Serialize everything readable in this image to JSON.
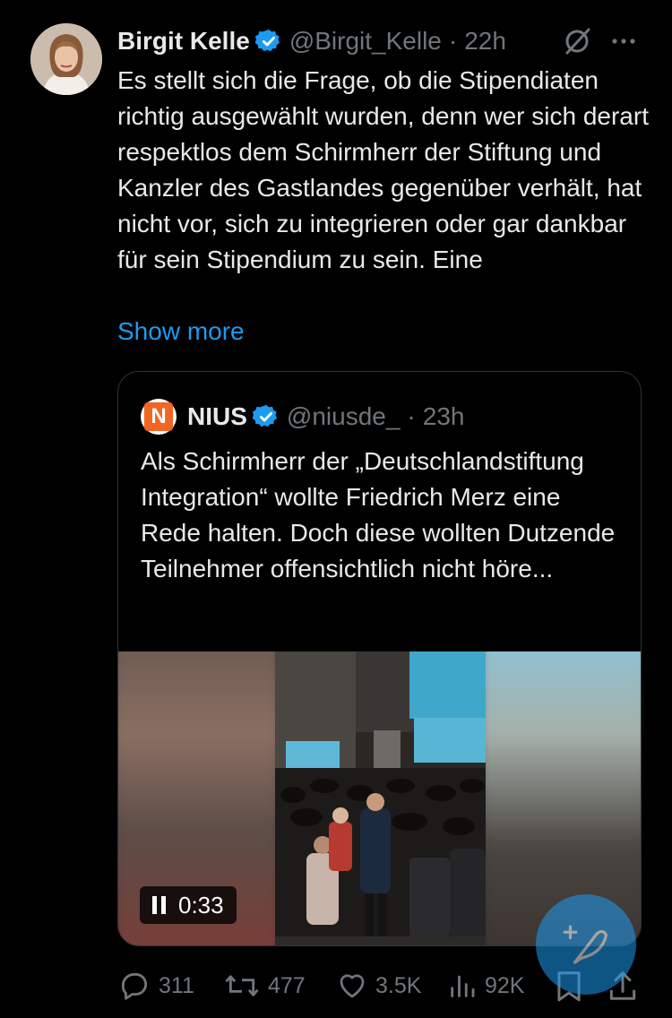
{
  "author": {
    "name": "Birgit Kelle",
    "handle": "@Birgit_Kelle",
    "separator": "·",
    "time": "22h"
  },
  "tweet": {
    "text": "Es stellt sich die Frage, ob die Stipendiaten richtig ausgewählt wurden, denn wer sich derart respektlos dem Schirmherr der Stiftung und Kanzler des Gastlandes gegenüber verhält, hat nicht vor, sich zu integrieren oder gar dankbar für sein Stipendium zu sein. Eine",
    "show_more": "Show more"
  },
  "quote": {
    "logo_letter": "N",
    "name": "NIUS",
    "handle": "@niusde_",
    "separator": "·",
    "time": "23h",
    "text": "Als Schirmherr der „Deutschlandstiftung Integration“ wollte Friedrich Merz eine Rede halten. Doch diese wollten Dutzende Teilnehmer offensichtlich nicht höre...",
    "video": {
      "duration": "0:33",
      "state": "playing"
    }
  },
  "actions": {
    "replies": "311",
    "reposts": "477",
    "likes": "3.5K",
    "views": "92K"
  },
  "icons": {
    "verified": "verified-badge-icon",
    "grok": "grok-icon",
    "more": "more-options-icon",
    "reply": "reply-icon",
    "repost": "repost-icon",
    "like": "like-icon",
    "views": "views-icon",
    "bookmark": "bookmark-icon",
    "share": "share-icon",
    "compose": "compose-icon"
  },
  "colors": {
    "background": "#000000",
    "text": "#e7e9ea",
    "muted": "#71767b",
    "accent": "#1d9bf0",
    "border": "#2f3336"
  }
}
